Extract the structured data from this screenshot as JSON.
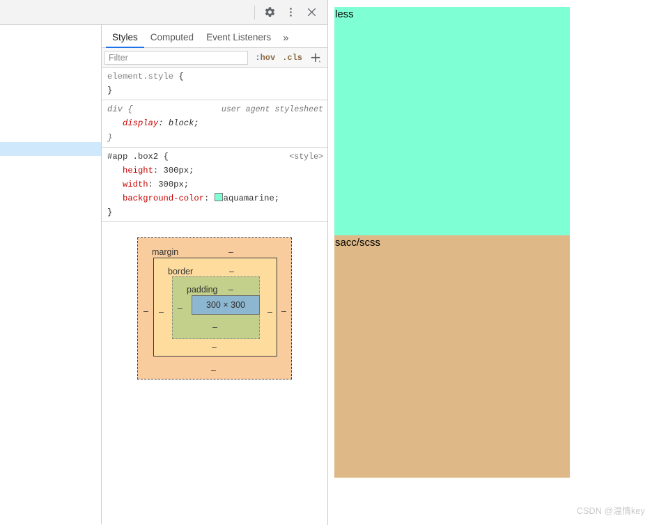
{
  "page": {
    "boxes": [
      {
        "label": "less",
        "color": "#7FFFD4"
      },
      {
        "label": "sacc/scss",
        "color": "#DEB887"
      }
    ],
    "watermark": "CSDN @温情key"
  },
  "devtools": {
    "toolbar": {
      "settings_title": "Settings",
      "more_title": "Customize and control DevTools",
      "close_title": "Close DevTools"
    },
    "tabs": [
      {
        "label": "Styles",
        "active": true
      },
      {
        "label": "Computed",
        "active": false
      },
      {
        "label": "Event Listeners",
        "active": false
      }
    ],
    "tabs_overflow": "»",
    "filter": {
      "value": "",
      "placeholder": "Filter",
      "hov_colon": ":",
      "hov_label": "hov",
      "cls_label": ".cls",
      "new_rule_label": "+"
    },
    "rules": [
      {
        "selector": "element.style",
        "selector_style": "gray",
        "origin": "",
        "open_brace": "{",
        "close_brace": "}",
        "declarations": []
      },
      {
        "selector": "div",
        "selector_style": "italic",
        "origin": "user agent stylesheet",
        "open_brace": "{",
        "close_brace": "}",
        "declarations": [
          {
            "name": "display",
            "value": "block;",
            "italic": true,
            "swatch": ""
          }
        ]
      },
      {
        "selector": "#app .box2",
        "selector_style": "normal",
        "origin": "<style>",
        "open_brace": "{",
        "close_brace": "}",
        "declarations": [
          {
            "name": "height",
            "value": "300px;",
            "italic": false,
            "swatch": ""
          },
          {
            "name": "width",
            "value": "300px;",
            "italic": false,
            "swatch": ""
          },
          {
            "name": "background-color",
            "value": "aquamarine;",
            "italic": false,
            "swatch": "#7FFFD4"
          }
        ]
      }
    ],
    "box_model": {
      "margin_label": "margin",
      "border_label": "border",
      "padding_label": "padding",
      "content_label": "300 × 300",
      "margin_top": "–",
      "margin_right": "–",
      "margin_bottom": "–",
      "margin_left": "–",
      "border_top": "–",
      "border_right": "–",
      "border_bottom": "–",
      "border_left": "–",
      "padding_top": "–",
      "padding_right": "–",
      "padding_bottom": "–",
      "padding_left": "–",
      "colors": {
        "margin": "#F9CC9D",
        "border": "#FDDC9E",
        "padding": "#C3D08B",
        "content": "#8DB7D0"
      }
    }
  }
}
